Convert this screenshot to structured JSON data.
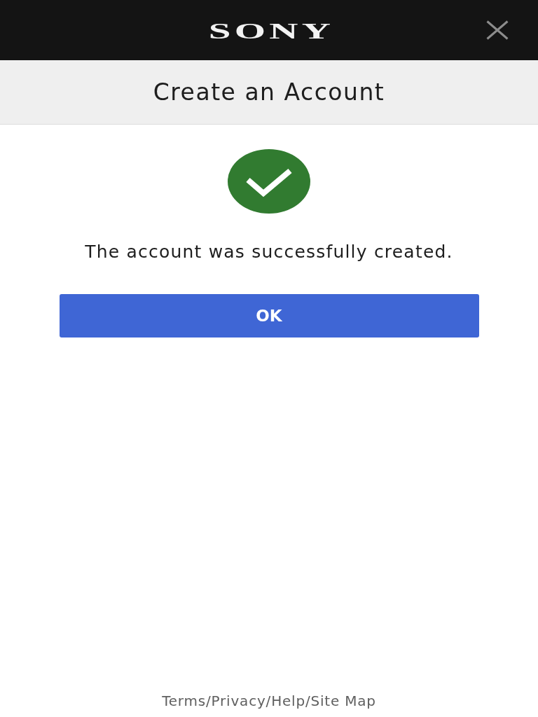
{
  "header": {
    "logo": "SONY"
  },
  "title_bar": {
    "title": "Create an Account"
  },
  "result": {
    "message": "The account was successfully created.",
    "button": "OK"
  },
  "footer": {
    "links": [
      "Terms",
      "Privacy",
      "Help",
      "Site Map"
    ],
    "separators": [
      "/",
      "/",
      "/"
    ]
  }
}
